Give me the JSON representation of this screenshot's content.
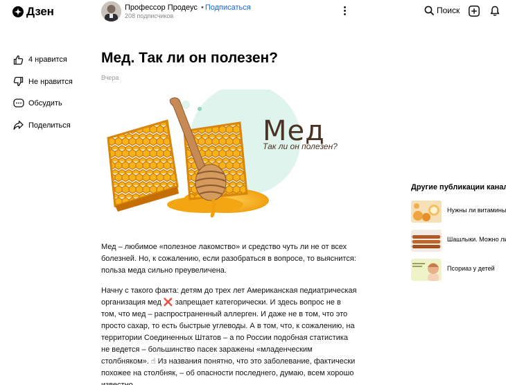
{
  "header": {
    "logo_text": "Дзен",
    "author_name": "Профессор Продеус",
    "separator": "•",
    "subscribe_label": "Подписаться",
    "subscribers": "208 подписчиков",
    "search_label": "Поиск"
  },
  "actions": {
    "like": "4 нравится",
    "dislike": "Не нравится",
    "comment": "Обсудить",
    "share": "Поделиться"
  },
  "article": {
    "title": "Мед. Так ли он полезен?",
    "date": "Вчера",
    "hero_title": "Мед",
    "hero_subtitle": "Так ли он полезен?",
    "paragraph1": "Мед – любимое «полезное лакомство» и средство чуть ли не от всех болезней. Но, к сожалению, если разобраться в вопросе, то выяснится: польза меда сильно преувеличена.",
    "paragraph2": "Начну с такого факта: детям до трех лет Американская педиатрическая организация мед ❌ запрещает категорически. И здесь вопрос не в том, что мед – распространенный аллерген. И даже не в том, что это просто сахар, то есть быстрые углеводы. А в том, что, к сожалению, на территории Соединенных Штатов – а по России подобная статистика не ведется – большинство пасек заражены «младенческим столбняком». ☝ Из названия понятно, что это заболевание, фактически похожее на столбняк, – об опасности последнего, думаю, всем хорошо известно."
  },
  "sidebar": {
    "title": "Другие публикации канала",
    "items": [
      {
        "title": "Нужны ли витамины"
      },
      {
        "title": "Шашлыки. Можно ли"
      },
      {
        "title": "Псориаз у детей"
      }
    ]
  },
  "colors": {
    "link": "#1565d8",
    "honey": "#f2a20f",
    "mint": "#dff4ec",
    "hero_text": "#4a3225"
  }
}
